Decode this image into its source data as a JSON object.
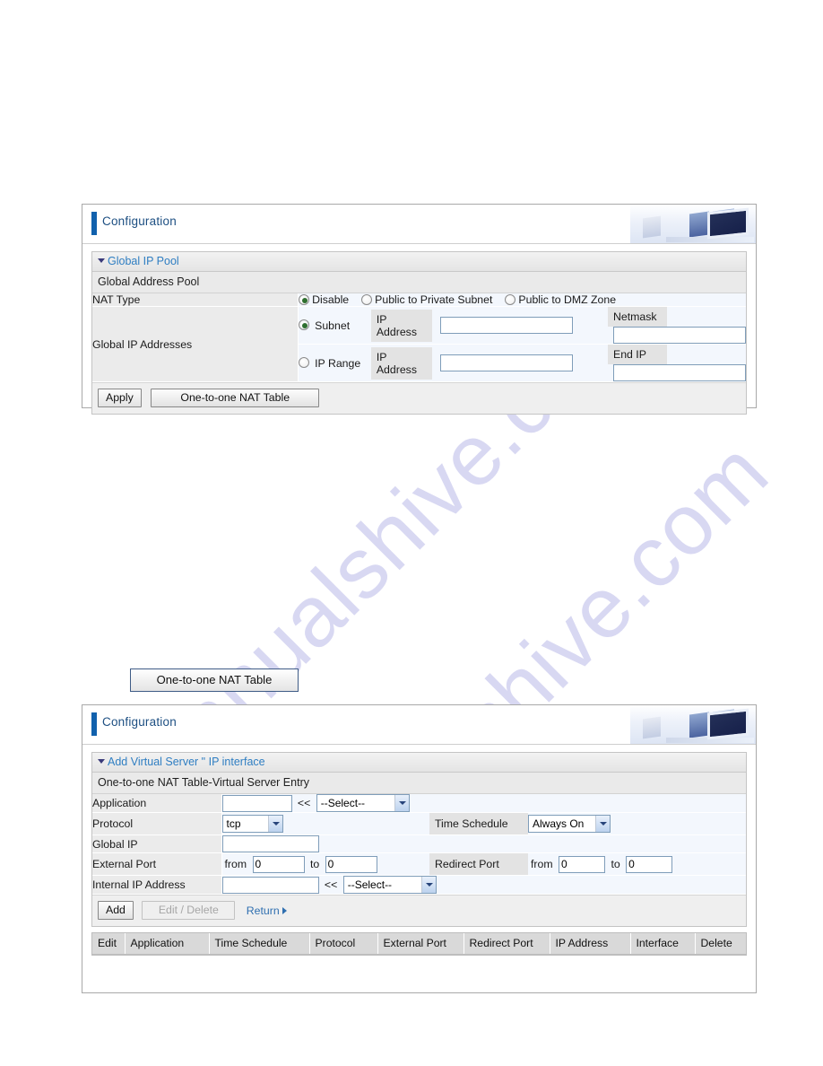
{
  "watermark": {
    "line1": "manualshive.com",
    "line2": "manualshive.com"
  },
  "panel1": {
    "header_title": "Configuration",
    "section_title": "Global IP Pool",
    "section_sub": "Global Address Pool",
    "rows": {
      "nat_type_label": "NAT Type",
      "nat_options": [
        {
          "label": "Disable",
          "selected": true
        },
        {
          "label": "Public to Private Subnet",
          "selected": false
        },
        {
          "label": "Public to DMZ Zone",
          "selected": false
        }
      ],
      "global_ip_label": "Global IP Addresses",
      "subnet": {
        "radio_label": "Subnet",
        "selected": true,
        "ip_label": "IP Address",
        "ip_value": "",
        "second_label": "Netmask",
        "second_value": ""
      },
      "iprange": {
        "radio_label": "IP Range",
        "selected": false,
        "ip_label": "IP Address",
        "ip_value": "",
        "second_label": "End IP",
        "second_value": ""
      }
    },
    "buttons": {
      "apply": "Apply",
      "nat_table": "One-to-one NAT Table"
    }
  },
  "standalone_button": {
    "label": "One-to-one NAT Table"
  },
  "panel2": {
    "header_title": "Configuration",
    "section_title": "Add Virtual Server \" IP interface",
    "section_sub": "One-to-one NAT Table-Virtual Server Entry",
    "rows": {
      "application": {
        "label": "Application",
        "value": "",
        "arrows": "<<",
        "select_value": "--Select--"
      },
      "protocol": {
        "label": "Protocol",
        "select_value": "tcp",
        "time_schedule_label": "Time Schedule",
        "time_schedule_value": "Always On"
      },
      "global_ip": {
        "label": "Global IP",
        "value": ""
      },
      "external_port": {
        "label": "External Port",
        "from_label": "from",
        "from_value": "0",
        "to_label": "to",
        "to_value": "0",
        "redirect_label": "Redirect Port",
        "redirect_from_label": "from",
        "redirect_from_value": "0",
        "redirect_to_label": "to",
        "redirect_to_value": "0"
      },
      "internal_ip": {
        "label": "Internal IP Address",
        "value": "",
        "arrows": "<<",
        "select_value": "--Select--"
      }
    },
    "buttons": {
      "add": "Add",
      "edit_delete": "Edit / Delete",
      "return": "Return"
    },
    "grid_headers": [
      "Edit",
      "Application",
      "Time Schedule",
      "Protocol",
      "External Port",
      "Redirect Port",
      "IP Address",
      "Interface",
      "Delete"
    ]
  }
}
